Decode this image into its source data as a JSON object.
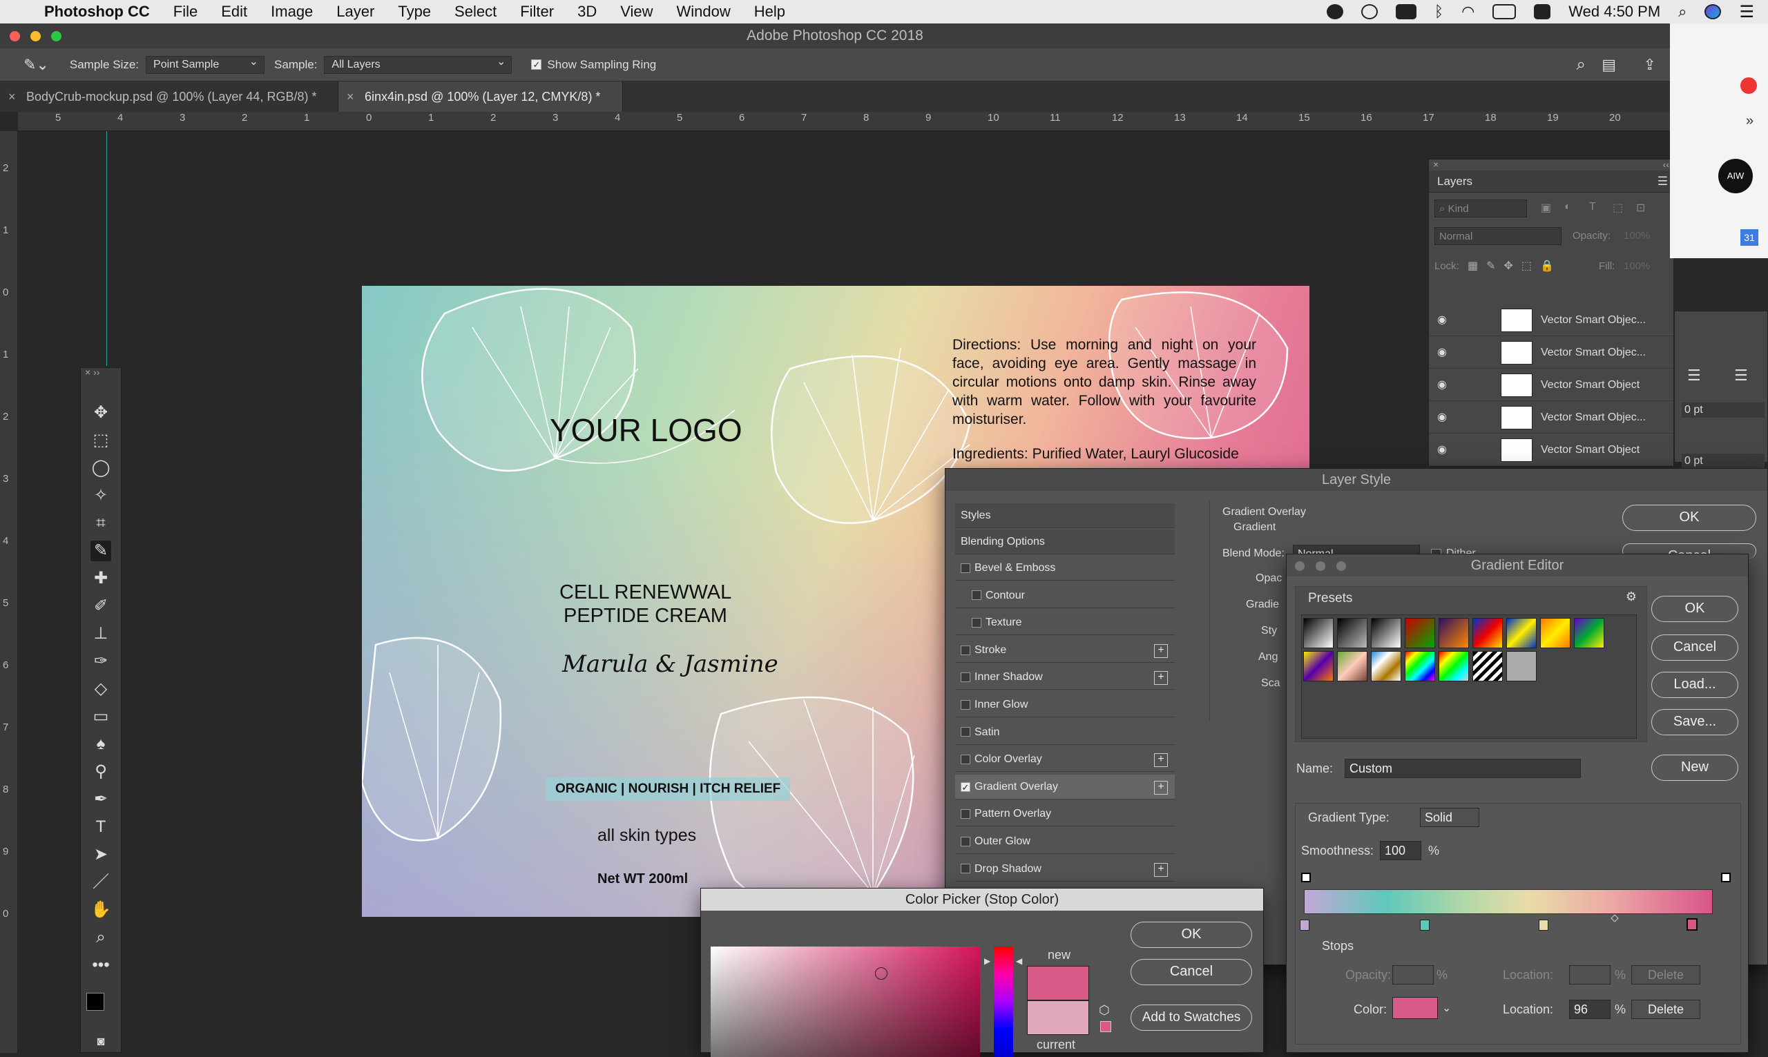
{
  "menubar": {
    "app": "Photoshop CC",
    "items": [
      "File",
      "Edit",
      "Image",
      "Layer",
      "Type",
      "Select",
      "Filter",
      "3D",
      "View",
      "Window",
      "Help"
    ],
    "clock": "Wed 4:50 PM"
  },
  "window": {
    "title": "Adobe Photoshop CC 2018"
  },
  "options": {
    "sample_size_label": "Sample Size:",
    "sample_size_value": "Point Sample",
    "sample_label": "Sample:",
    "sample_value": "All Layers",
    "show_ring_label": "Show Sampling Ring",
    "show_ring_checked": true
  },
  "tabs": [
    {
      "label": "BodyCrub-mockup.psd @ 100% (Layer 44, RGB/8) *",
      "active": false
    },
    {
      "label": "6inx4in.psd @ 100% (Layer 12, CMYK/8) *",
      "active": true
    }
  ],
  "ruler_h": [
    "5",
    "4",
    "3",
    "2",
    "1",
    "0",
    "1",
    "2",
    "3",
    "4",
    "5",
    "6",
    "7",
    "8",
    "9",
    "10",
    "11",
    "12",
    "13",
    "14",
    "15",
    "16",
    "17",
    "18",
    "19",
    "20"
  ],
  "ruler_v": [
    "2",
    "1",
    "0",
    "1",
    "2",
    "3",
    "4",
    "5",
    "6",
    "7",
    "8",
    "9",
    "0"
  ],
  "artwork": {
    "logo": "YOUR LOGO",
    "directions": "Directions: Use morning and night on your face, avoiding eye area. Gently massage in circular motions onto damp skin. Rinse away with warm water. Follow with your favourite moisturiser.",
    "ingredients": "Ingredients: Purified Water, Lauryl Glucoside",
    "product_line1": "CELL RENEWWAL",
    "product_line2": "PEPTIDE CREAM",
    "script": "Marula & Jasmine",
    "tagline": "ORGANIC | NOURISH | ITCH RELIEF",
    "skin": "all skin types",
    "net": "Net WT 200ml"
  },
  "layers_panel": {
    "title": "Layers",
    "kind_placeholder": "Kind",
    "blend": "Normal",
    "opacity_label": "Opacity:",
    "opacity_value": "100%",
    "lock_label": "Lock:",
    "fill_label": "Fill:",
    "fill_value": "100%",
    "layers": [
      "Vector Smart Objec...",
      "Vector Smart Objec...",
      "Vector Smart Object",
      "Vector Smart Objec...",
      "Vector Smart Object"
    ]
  },
  "side_panel": {
    "pt1": "0 pt",
    "pt2": "0 pt",
    "calendar_day": "31",
    "avatar": "AIW"
  },
  "layer_style": {
    "title": "Layer Style",
    "styles_header": "Styles",
    "blending_options": "Blending Options",
    "rows": [
      {
        "label": "Bevel & Emboss",
        "checked": false,
        "plus": false,
        "indent": false
      },
      {
        "label": "Contour",
        "checked": false,
        "plus": false,
        "indent": true
      },
      {
        "label": "Texture",
        "checked": false,
        "plus": false,
        "indent": true
      },
      {
        "label": "Stroke",
        "checked": false,
        "plus": true,
        "indent": false
      },
      {
        "label": "Inner Shadow",
        "checked": false,
        "plus": true,
        "indent": false
      },
      {
        "label": "Inner Glow",
        "checked": false,
        "plus": false,
        "indent": false
      },
      {
        "label": "Satin",
        "checked": false,
        "plus": false,
        "indent": false
      },
      {
        "label": "Color Overlay",
        "checked": false,
        "plus": true,
        "indent": false
      },
      {
        "label": "Gradient Overlay",
        "checked": true,
        "plus": true,
        "indent": false
      },
      {
        "label": "Pattern Overlay",
        "checked": false,
        "plus": false,
        "indent": false
      },
      {
        "label": "Outer Glow",
        "checked": false,
        "plus": false,
        "indent": false
      },
      {
        "label": "Drop Shadow",
        "checked": false,
        "plus": true,
        "indent": false
      }
    ],
    "section_title": "Gradient Overlay",
    "section_sub": "Gradient",
    "blend_mode_label": "Blend Mode:",
    "blend_mode_value": "Normal",
    "dither_label": "Dither",
    "opacity_label": "Opac",
    "gradient_label": "Gradie",
    "style_label": "Sty",
    "angle_label": "Ang",
    "scale_label": "Sca",
    "ok": "OK",
    "cancel_partial": "Cancel"
  },
  "gradient_editor": {
    "title": "Gradient Editor",
    "presets_label": "Presets",
    "ok": "OK",
    "cancel": "Cancel",
    "load": "Load...",
    "save": "Save...",
    "name_label": "Name:",
    "name_value": "Custom",
    "new": "New",
    "type_label": "Gradient Type:",
    "type_value": "Solid",
    "smoothness_label": "Smoothness:",
    "smoothness_value": "100",
    "pct": "%",
    "stops_label": "Stops",
    "opacity_label": "Opacity:",
    "location_label": "Location:",
    "delete": "Delete",
    "color_label": "Color:",
    "color_location": "96",
    "stop_color": "#d85a88"
  },
  "color_picker": {
    "title": "Color Picker (Stop Color)",
    "ok": "OK",
    "cancel": "Cancel",
    "add_swatches": "Add to Swatches",
    "new_label": "new",
    "current_label": "current",
    "new_color": "#d85a88",
    "current_color": "#e1a8bc"
  }
}
